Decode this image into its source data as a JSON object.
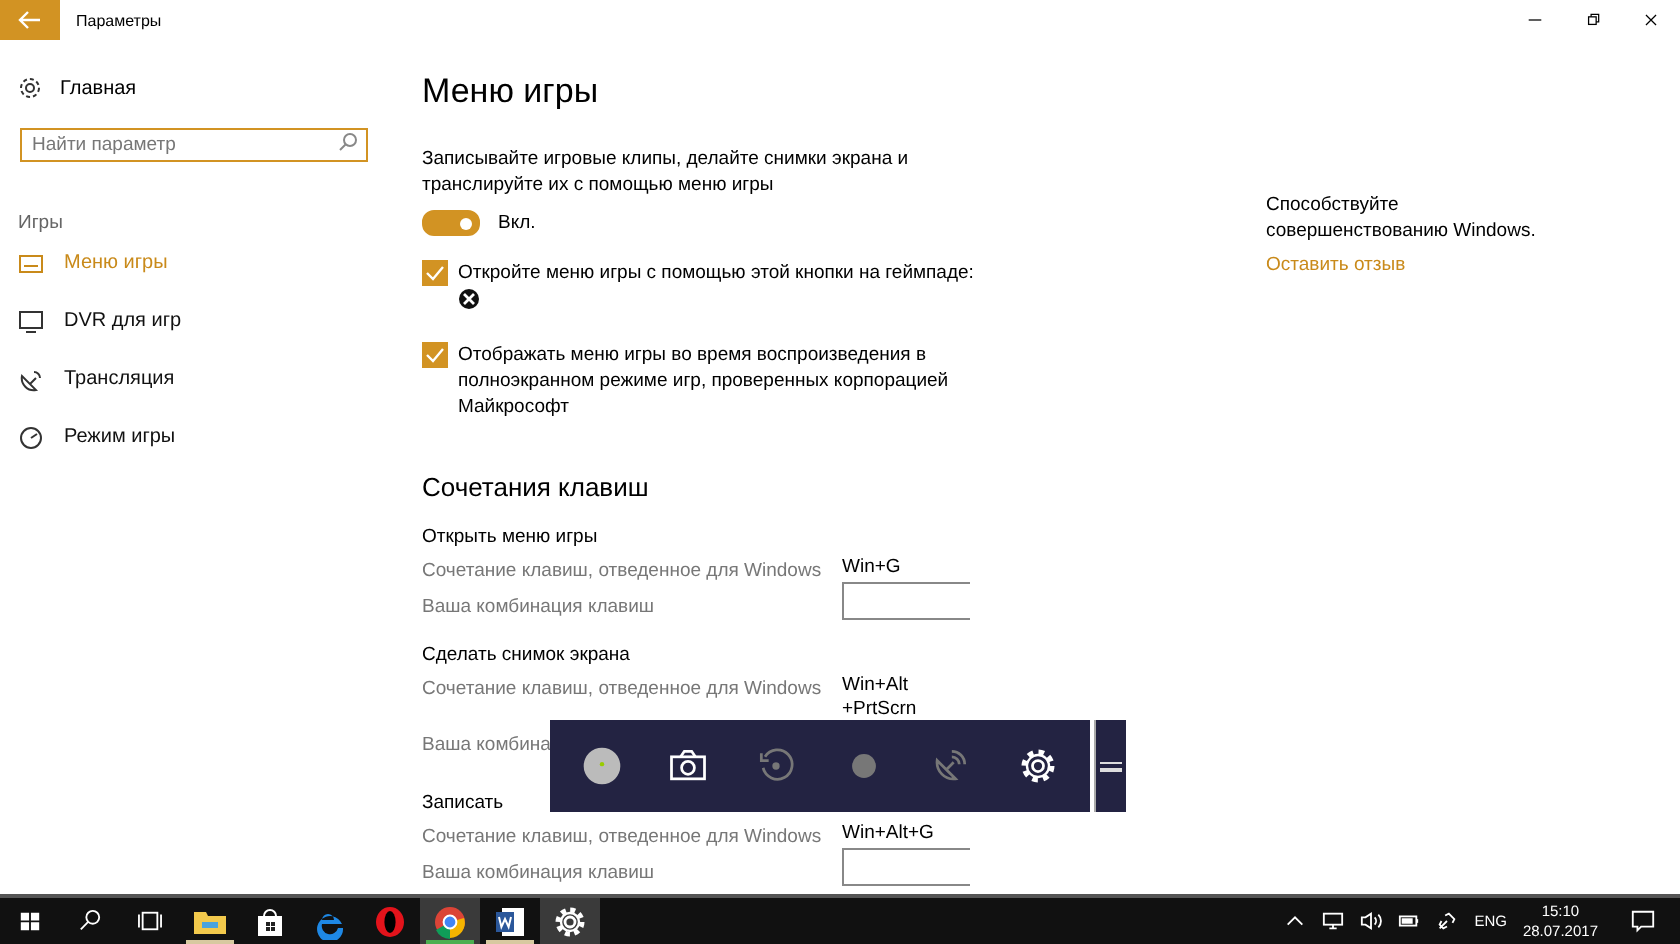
{
  "window": {
    "title": "Параметры"
  },
  "sidebar": {
    "home": "Главная",
    "search": {
      "placeholder": "Найти параметр"
    },
    "section": "Игры",
    "items": [
      {
        "label": "Меню игры",
        "selected": true
      },
      {
        "label": "DVR для игр",
        "selected": false
      },
      {
        "label": "Трансляция",
        "selected": false
      },
      {
        "label": "Режим игры",
        "selected": false
      }
    ]
  },
  "main": {
    "title": "Меню игры",
    "description": "Записывайте игровые клипы, делайте снимки экрана и транслируйте их с помощью меню игры",
    "toggle": {
      "on": true,
      "label": "Вкл."
    },
    "checkboxes": [
      {
        "label": "Откройте меню игры с помощью этой кнопки на геймпаде:",
        "checked": true
      },
      {
        "label": "Отображать меню игры во время воспроизведения в полноэкранном режиме игр, проверенных корпорацией Майкрософт",
        "checked": true
      }
    ],
    "shortcuts": {
      "title": "Сочетания клавиш",
      "groups": [
        {
          "title": "Открыть меню игры",
          "rows": [
            {
              "kind": "system",
              "label": "Сочетание клавиш, отведенное для Windows",
              "value": "Win+G"
            },
            {
              "kind": "custom",
              "label": "Ваша комбинация клавиш"
            }
          ]
        },
        {
          "title": "Сделать снимок экрана",
          "rows": [
            {
              "kind": "system",
              "label": "Сочетание клавиш, отведенное для Windows",
              "value": "Win+Alt\n+PrtScrn"
            },
            {
              "kind": "covered",
              "label": "Ваша комбина"
            }
          ]
        },
        {
          "title": "Записать",
          "rows": [
            {
              "kind": "system",
              "label": "Сочетание клавиш, отведенное для Windows",
              "value": "Win+Alt+G"
            },
            {
              "kind": "custom",
              "label": "Ваша комбинация клавиш"
            }
          ]
        }
      ]
    }
  },
  "feedback": {
    "text": "Способствуйте совершенствованию Windows.",
    "link": "Оставить отзыв"
  },
  "taskbar": {
    "apps": [
      {
        "running": true,
        "selected": false
      },
      {
        "running": false,
        "selected": false
      },
      {
        "running": false,
        "selected": false
      },
      {
        "running": false,
        "selected": false
      },
      {
        "running": true,
        "selected": true
      },
      {
        "running": true,
        "selected": false
      },
      {
        "running": false,
        "selected": true
      }
    ],
    "language": "ENG",
    "time": "15:10",
    "date": "28.07.2017"
  }
}
